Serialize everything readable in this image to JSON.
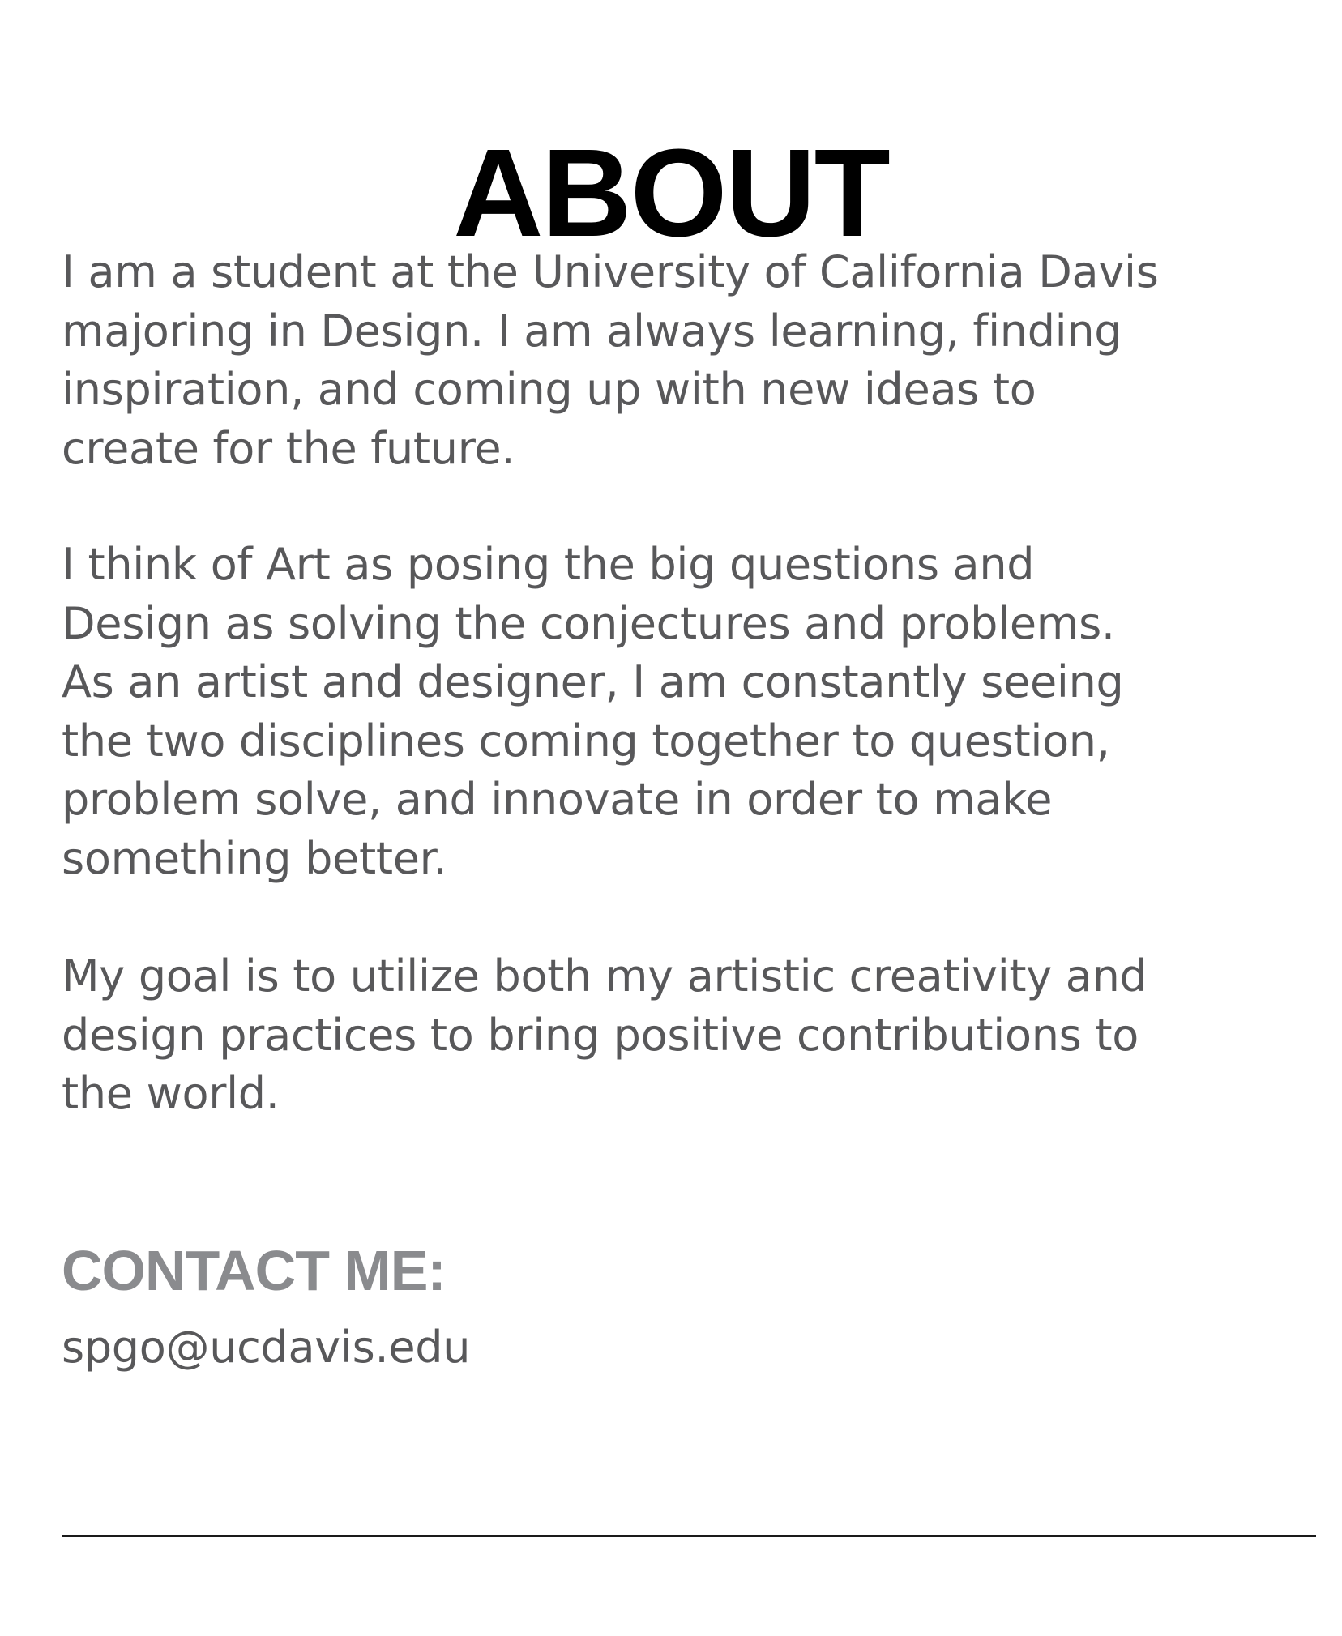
{
  "about": {
    "title": "ABOUT",
    "paragraph1": [
      "I am a student at the University of California Davis",
      "majoring in Design. I am always learning, finding",
      "inspiration, and coming up with new ideas to",
      "create for the future."
    ],
    "paragraph2": [
      "I think of Art as posing the big questions and",
      "Design as solving the conjectures and problems.",
      "As an artist and designer, I am constantly seeing",
      "the two disciplines coming together to question,",
      "problem solve, and innovate in order to make",
      "something better."
    ],
    "paragraph3": [
      "My goal is to utilize both my artistic creativity and",
      "design practices to bring positive contributions to",
      "the world."
    ]
  },
  "contact": {
    "heading": "CONTACT ME:",
    "email": "spgo@ucdavis.edu"
  },
  "colors": {
    "title": "#000000",
    "body_text": "#58585a",
    "contact_heading": "#8a8b8e",
    "divider": "#1a1a1a",
    "background": "#ffffff"
  }
}
